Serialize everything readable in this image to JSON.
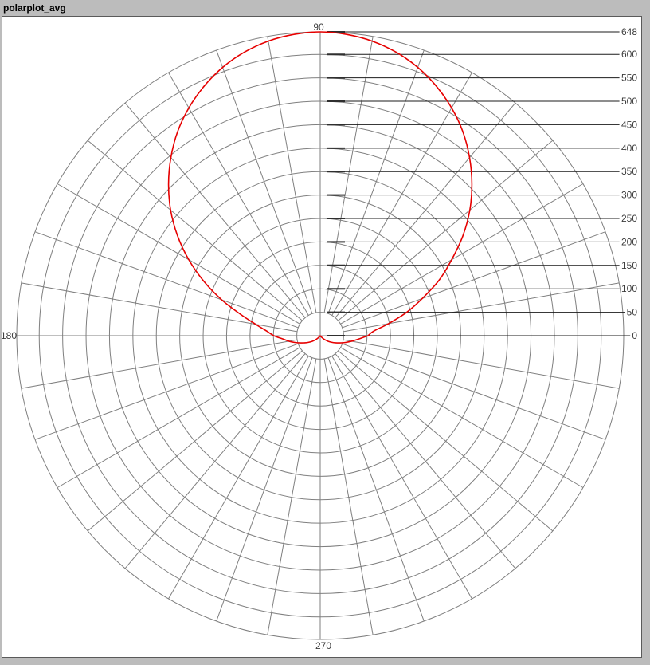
{
  "window": {
    "title": "polarplot_avg"
  },
  "colors": {
    "window_bg": "#bcbcbc",
    "canvas_bg": "#ffffff",
    "canvas_border": "#5a5a5a",
    "grid": "#7f7f7f",
    "tick": "#2f2f2f",
    "leader": "#1b1b1b",
    "label_text": "#3c3c3c",
    "title_text": "#000000",
    "curve": "#e60000"
  },
  "chart_data": {
    "type": "line",
    "subtype": "polar",
    "title": "polarplot_avg",
    "grid": true,
    "legend": "none",
    "r_axis": {
      "max": 648,
      "min": 0,
      "circle_step": 50,
      "tick_labels": [
        "648",
        "600",
        "550",
        "500",
        "450",
        "400",
        "350",
        "300",
        "250",
        "200",
        "150",
        "100",
        "50",
        "0"
      ],
      "tick_values": [
        648,
        600,
        550,
        500,
        450,
        400,
        350,
        300,
        250,
        200,
        150,
        100,
        50,
        0
      ],
      "label_side": "right"
    },
    "angle_axis": {
      "spoke_step_deg": 10,
      "direction": "ccw",
      "zero_position": "right",
      "labels": [
        {
          "deg": 90,
          "text": "90"
        },
        {
          "deg": 180,
          "text": "180"
        },
        {
          "deg": 270,
          "text": "270"
        }
      ]
    },
    "series": [
      {
        "name": "avg",
        "color": "#e60000",
        "points_deg_r": [
          [
            0,
            102
          ],
          [
            5,
            115
          ],
          [
            10,
            148
          ],
          [
            15,
            190
          ],
          [
            20,
            232
          ],
          [
            25,
            280
          ],
          [
            30,
            324
          ],
          [
            35,
            372
          ],
          [
            40,
            417
          ],
          [
            45,
            458
          ],
          [
            50,
            496
          ],
          [
            55,
            531
          ],
          [
            60,
            561
          ],
          [
            65,
            587
          ],
          [
            70,
            609
          ],
          [
            75,
            626
          ],
          [
            80,
            638
          ],
          [
            85,
            645
          ],
          [
            90,
            648
          ],
          [
            95,
            645
          ],
          [
            100,
            638
          ],
          [
            105,
            626
          ],
          [
            110,
            609
          ],
          [
            115,
            587
          ],
          [
            120,
            561
          ],
          [
            125,
            531
          ],
          [
            130,
            496
          ],
          [
            135,
            458
          ],
          [
            140,
            417
          ],
          [
            145,
            372
          ],
          [
            150,
            324
          ],
          [
            155,
            274
          ],
          [
            160,
            224
          ],
          [
            165,
            176
          ],
          [
            170,
            140
          ],
          [
            175,
            115
          ],
          [
            180,
            99
          ],
          [
            185,
            80
          ],
          [
            190,
            68
          ],
          [
            195,
            56
          ],
          [
            200,
            45
          ],
          [
            205,
            36
          ],
          [
            210,
            28
          ],
          [
            215,
            21
          ],
          [
            220,
            14
          ],
          [
            225,
            8
          ],
          [
            230,
            3
          ],
          [
            235,
            1
          ],
          [
            240,
            0
          ],
          [
            245,
            0
          ],
          [
            250,
            0
          ],
          [
            255,
            0
          ],
          [
            260,
            0
          ],
          [
            265,
            0
          ],
          [
            270,
            0
          ],
          [
            275,
            0
          ],
          [
            280,
            0
          ],
          [
            285,
            0
          ],
          [
            290,
            0
          ],
          [
            295,
            0
          ],
          [
            300,
            0
          ],
          [
            305,
            1
          ],
          [
            310,
            3
          ],
          [
            315,
            8
          ],
          [
            320,
            14
          ],
          [
            325,
            21
          ],
          [
            330,
            28
          ],
          [
            335,
            36
          ],
          [
            340,
            45
          ],
          [
            345,
            56
          ],
          [
            350,
            68
          ],
          [
            355,
            82
          ],
          [
            360,
            102
          ]
        ]
      }
    ]
  }
}
